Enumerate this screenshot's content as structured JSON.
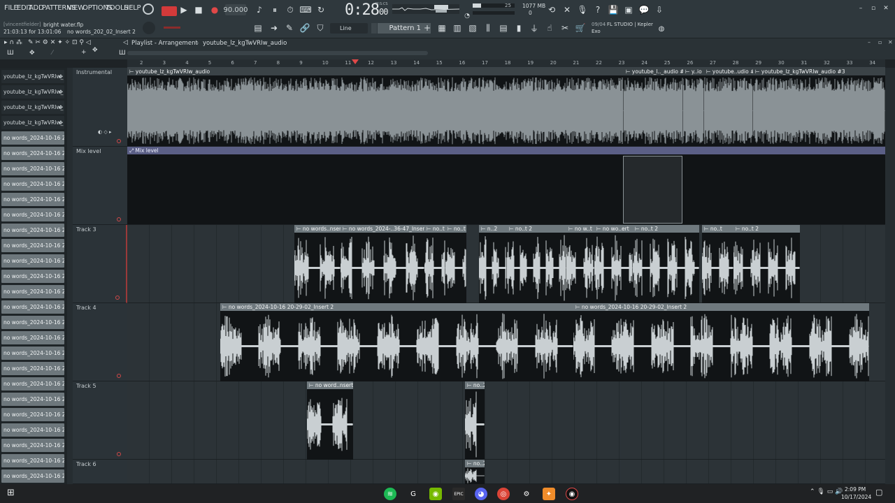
{
  "menu": [
    "FILE",
    "EDIT",
    "ADD",
    "PATTERNS",
    "VIEW",
    "OPTIONS",
    "TOOLS",
    "HELP"
  ],
  "transport": {
    "tempo": "90.000",
    "time": "0:28",
    "time_sub": "00",
    "label": "M:S:CS"
  },
  "project": {
    "user": "[vincentfielder]",
    "file": "bright water.flp",
    "clock": "21:03:13 for 13:01:06",
    "hint": "no words_202_02_Insert 2"
  },
  "meters": {
    "mem": "1077 MB",
    "cpu": "25",
    "poly": "0"
  },
  "pattern": {
    "snap": "Line",
    "name": "Pattern 1"
  },
  "news": {
    "date": "09/04",
    "text": "FL STUDIO | Kepler",
    "sub": "Exo"
  },
  "playlist": {
    "title": "Playlist - Arrangement",
    "clip": "youtube_lz_kgTwVRIw_audio"
  },
  "ruler": [
    "2",
    "3",
    "4",
    "5",
    "6",
    "7",
    "8",
    "9",
    "10",
    "11",
    "12",
    "13",
    "14",
    "15",
    "16",
    "17",
    "18",
    "19",
    "20",
    "21",
    "22",
    "23",
    "24",
    "25",
    "26",
    "27",
    "28",
    "29",
    "30",
    "31",
    "32",
    "33",
    "34"
  ],
  "browser": {
    "top": [
      "youtube_lz_kgTwVRIw_",
      "youtube_lz_kgTwVRIw_",
      "youtube_lz_kgTwVRIw_",
      "youtube_lz_kgTwVRIw_"
    ],
    "items": [
      "no words_2024-10-16 20",
      "no words_2024-10-16 20",
      "no words_2024-10-16 20",
      "no words_2024-10-16 20",
      "no words_2024-10-16 20",
      "no words_2024-10-16 20",
      "no words_2024-10-16 20",
      "no words_2024-10-16 20",
      "no words_2024-10-16 20",
      "no words_2024-10-16 20",
      "no words_2024-10-16 20",
      "no words_2024-10-16 20",
      "no words_2024-10-16 20",
      "no words_2024-10-16 20",
      "no words_2024-10-16 20",
      "no words_2024-10-16 20",
      "no words_2024-10-16 20",
      "no words_2024-10-16 20",
      "no words_2024-10-16 20",
      "no words_2024-10-16 20",
      "no words_2024-10-16 20",
      "no words_2024-10-16 20",
      "no words_2024-10-16 20"
    ]
  },
  "tracks": [
    "Instrumental",
    "Mix level",
    "Track 3",
    "Track 4",
    "Track 5",
    "Track 6"
  ],
  "clips": {
    "instr_main": "youtube_lz_kgTwVRIw_audio",
    "instr_b": "youtube_l.._audio #2",
    "instr_c": "y..io",
    "instr_d": "youtube..udio #4",
    "instr_e": "youtube_lz_kgTwVRIw_audio #3",
    "mix": "Mix level",
    "t3a": "no words..nsert",
    "t3b": "no words_2024-..36-47_Insert 2",
    "t3c": "no..t",
    "t3d": "no..t",
    "t3e": "n..2",
    "t3f": "no..t 2",
    "t3g": "no w..t",
    "t3h": "no wo..ert",
    "t3i": "no..t 2",
    "t3j": "no..t",
    "t3k": "no..t 2",
    "t4a": "no words_2024-10-16 20-29-02_Insert 2",
    "t4b": "no words_2024-10-16 20-29-02_Insert 2",
    "t5a": "no word..nsert 2",
    "t5b": "no..2",
    "t6a": "no..2"
  },
  "taskbar": {
    "time": "2:09 PM",
    "date": "10/17/2024"
  },
  "colors": {
    "clip_header": "#6f797e",
    "lane": "#2c3337",
    "wave": "#c9cfd2",
    "instr_wave": "#8a9296",
    "mix_bar": "#5b5f86"
  }
}
